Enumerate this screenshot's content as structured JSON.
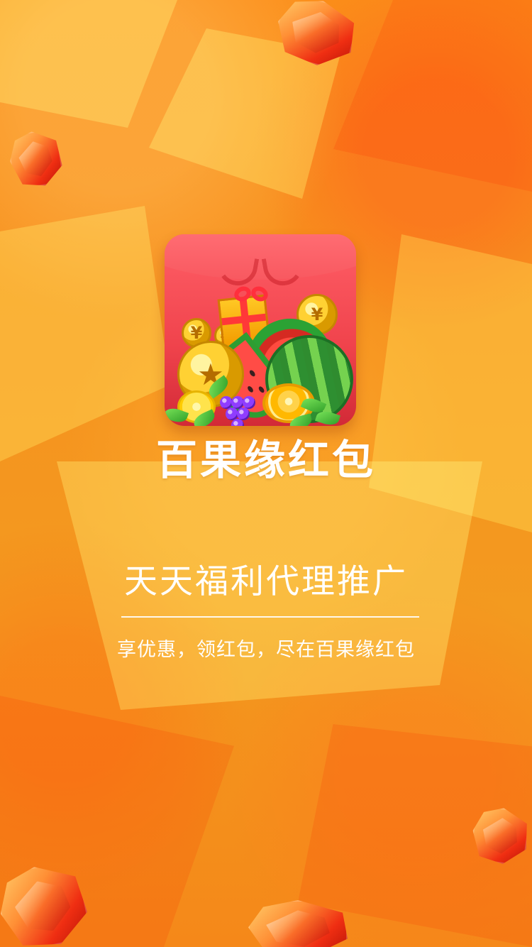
{
  "app": {
    "name": "百果缘红包"
  },
  "splash": {
    "headline": "天天福利代理推广",
    "subheadline": "享优惠，领红包，尽在百果缘红包"
  },
  "icons": {
    "app_logo": "fruit-red-envelope-icon"
  },
  "colors": {
    "background_primary": "#F3901F",
    "background_accent": "#FF7A21",
    "text": "#FFFFFF",
    "logo_red": "#F0434C"
  }
}
